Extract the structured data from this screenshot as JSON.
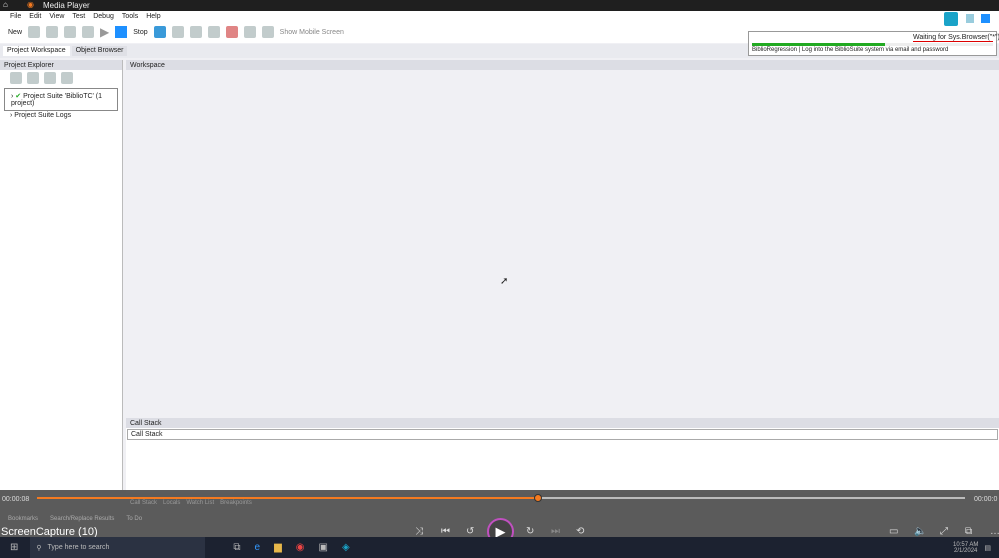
{
  "window": {
    "title": "Media Player"
  },
  "app": {
    "menu": [
      "File",
      "Edit",
      "View",
      "Test",
      "Debug",
      "Tools",
      "Help"
    ],
    "toolbar": {
      "new_label": "New",
      "stop_label": "Stop",
      "mobile_label": "Show Mobile Screen"
    },
    "tabs": [
      "Project Workspace",
      "Object Browser"
    ],
    "explorer": {
      "title": "Project Explorer",
      "items": [
        "Project Suite 'BiblioTC' (1 project)",
        "Project Suite Logs"
      ]
    },
    "workspace": {
      "title": "Workspace"
    },
    "callstack": {
      "title": "Call Stack",
      "column": "Call Stack",
      "tabs": [
        "Call Stack",
        "Locals",
        "Watch List",
        "Breakpoints"
      ]
    },
    "bottom_tabs": [
      "Bookmarks",
      "Search/Replace Results",
      "To Do"
    ],
    "popup": {
      "status": "Waiting for Sys.Browser(\"*\")",
      "message": "BiblioRegression | Log into the BiblioSuite system via email and password",
      "progress": 0.55
    }
  },
  "player": {
    "elapsed": "00:00:08",
    "total": "00:00:0",
    "progress": 0.54,
    "media_title": "ScreenCapture (10)",
    "accent": "#f47a20"
  },
  "taskbar": {
    "search_placeholder": "Type here to search",
    "time": "10:57 AM",
    "date": "2/1/2024"
  }
}
